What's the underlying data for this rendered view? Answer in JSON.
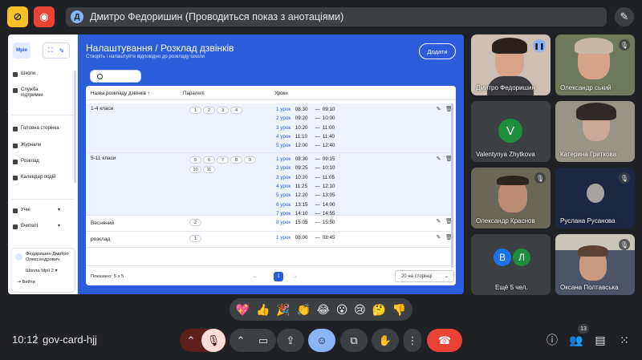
{
  "top": {
    "presenter_initial": "Д",
    "presenter_title": "Дмитро Федоришин (Проводиться показ з анотаціями)"
  },
  "app": {
    "logo": "Мрія",
    "sidebar": {
      "top_items": [
        {
          "label": "Школи",
          "icon": "school-icon"
        },
        {
          "label": "Служба підтримки",
          "icon": "headset-icon"
        }
      ],
      "main_items": [
        {
          "label": "Головна сторінка",
          "icon": "home-icon"
        },
        {
          "label": "Журнали",
          "icon": "journal-icon"
        },
        {
          "label": "Розклад",
          "icon": "schedule-icon"
        },
        {
          "label": "Календар подій",
          "icon": "calendar-icon"
        }
      ],
      "groups": [
        {
          "label": "Учні",
          "icon": "students-icon"
        },
        {
          "label": "Вчителі",
          "icon": "teachers-icon"
        }
      ],
      "user": {
        "name": "Федоришин Дмитро Олександрович",
        "school": "Школа Мрії 2",
        "logout": "Вийти"
      }
    },
    "breadcrumb": {
      "parent": "Налаштування",
      "sep": "/",
      "current": "Розклад дзвінків"
    },
    "subtitle": "Створіть і налаштуйте відповідно до розкладу школи",
    "add_button": "Додати",
    "table": {
      "headers": {
        "name": "Назва розкладу дзвінків",
        "parallels": "Паралелі",
        "lessons": "Уроки"
      },
      "rows": [
        {
          "name": "1-4 класи",
          "chips": [
            "1",
            "2",
            "3",
            "4"
          ],
          "lessons": [
            {
              "n": "1 урок",
              "start": "08:30",
              "end": "09:10"
            },
            {
              "n": "2 урок",
              "start": "09:20",
              "end": "10:00"
            },
            {
              "n": "3 урок",
              "start": "10:20",
              "end": "11:00"
            },
            {
              "n": "4 урок",
              "start": "11:10",
              "end": "11:40"
            },
            {
              "n": "5 урок",
              "start": "12:00",
              "end": "12:40"
            }
          ]
        },
        {
          "name": "5-11 класи",
          "chips": [
            "5",
            "6",
            "7",
            "8",
            "9",
            "10",
            "11"
          ],
          "lessons": [
            {
              "n": "1 урок",
              "start": "08:30",
              "end": "09:15"
            },
            {
              "n": "2 урок",
              "start": "09:25",
              "end": "10:10"
            },
            {
              "n": "3 урок",
              "start": "10:20",
              "end": "11:05"
            },
            {
              "n": "4 урок",
              "start": "11:25",
              "end": "12:10"
            },
            {
              "n": "5 урок",
              "start": "12:20",
              "end": "13:05"
            },
            {
              "n": "6 урок",
              "start": "13:15",
              "end": "14:00"
            },
            {
              "n": "7 урок",
              "start": "14:10",
              "end": "14:55"
            },
            {
              "n": "8 урок",
              "start": "15:05",
              "end": "15:50"
            }
          ]
        },
        {
          "name": "Весняний",
          "chips": [
            "2"
          ],
          "lessons": []
        },
        {
          "name": "розклад",
          "chips": [
            "1"
          ],
          "lessons": [
            {
              "n": "1 урок",
              "start": "08:00",
              "end": "08:45"
            }
          ]
        }
      ],
      "footer": {
        "shown": "Показано: 5 з 5",
        "page": "1",
        "per_page": "20 на сторінці"
      }
    }
  },
  "participants": [
    {
      "name": "Дмитро Федоришин",
      "bg": "#6b5a4e"
    },
    {
      "name": "Олександр ський",
      "bg": "#3f4a3c"
    },
    {
      "name": "Valentynya Zhytkova",
      "initial": "V",
      "bg": "#3c4043",
      "avatar_color": "#1e8e3e"
    },
    {
      "name": "Катерина Гриткова",
      "bg": "#8a857a"
    },
    {
      "name": "Олександр Краснов",
      "bg": "#5b5648"
    },
    {
      "name": "Руслана Русанова",
      "bg": "#1d2742"
    },
    {
      "name": "Ещё 5 чел.",
      "initials": [
        "В",
        "Л"
      ]
    },
    {
      "name": "Оксана Полтавська",
      "bg": "#4e5468"
    }
  ],
  "reactions": [
    "💖",
    "👍",
    "🎉",
    "👏",
    "😂",
    "😮",
    "😢",
    "🤔",
    "👎"
  ],
  "bottom": {
    "time": "10:12",
    "meeting_code": "gov-card-hjj",
    "people_count": "13"
  }
}
